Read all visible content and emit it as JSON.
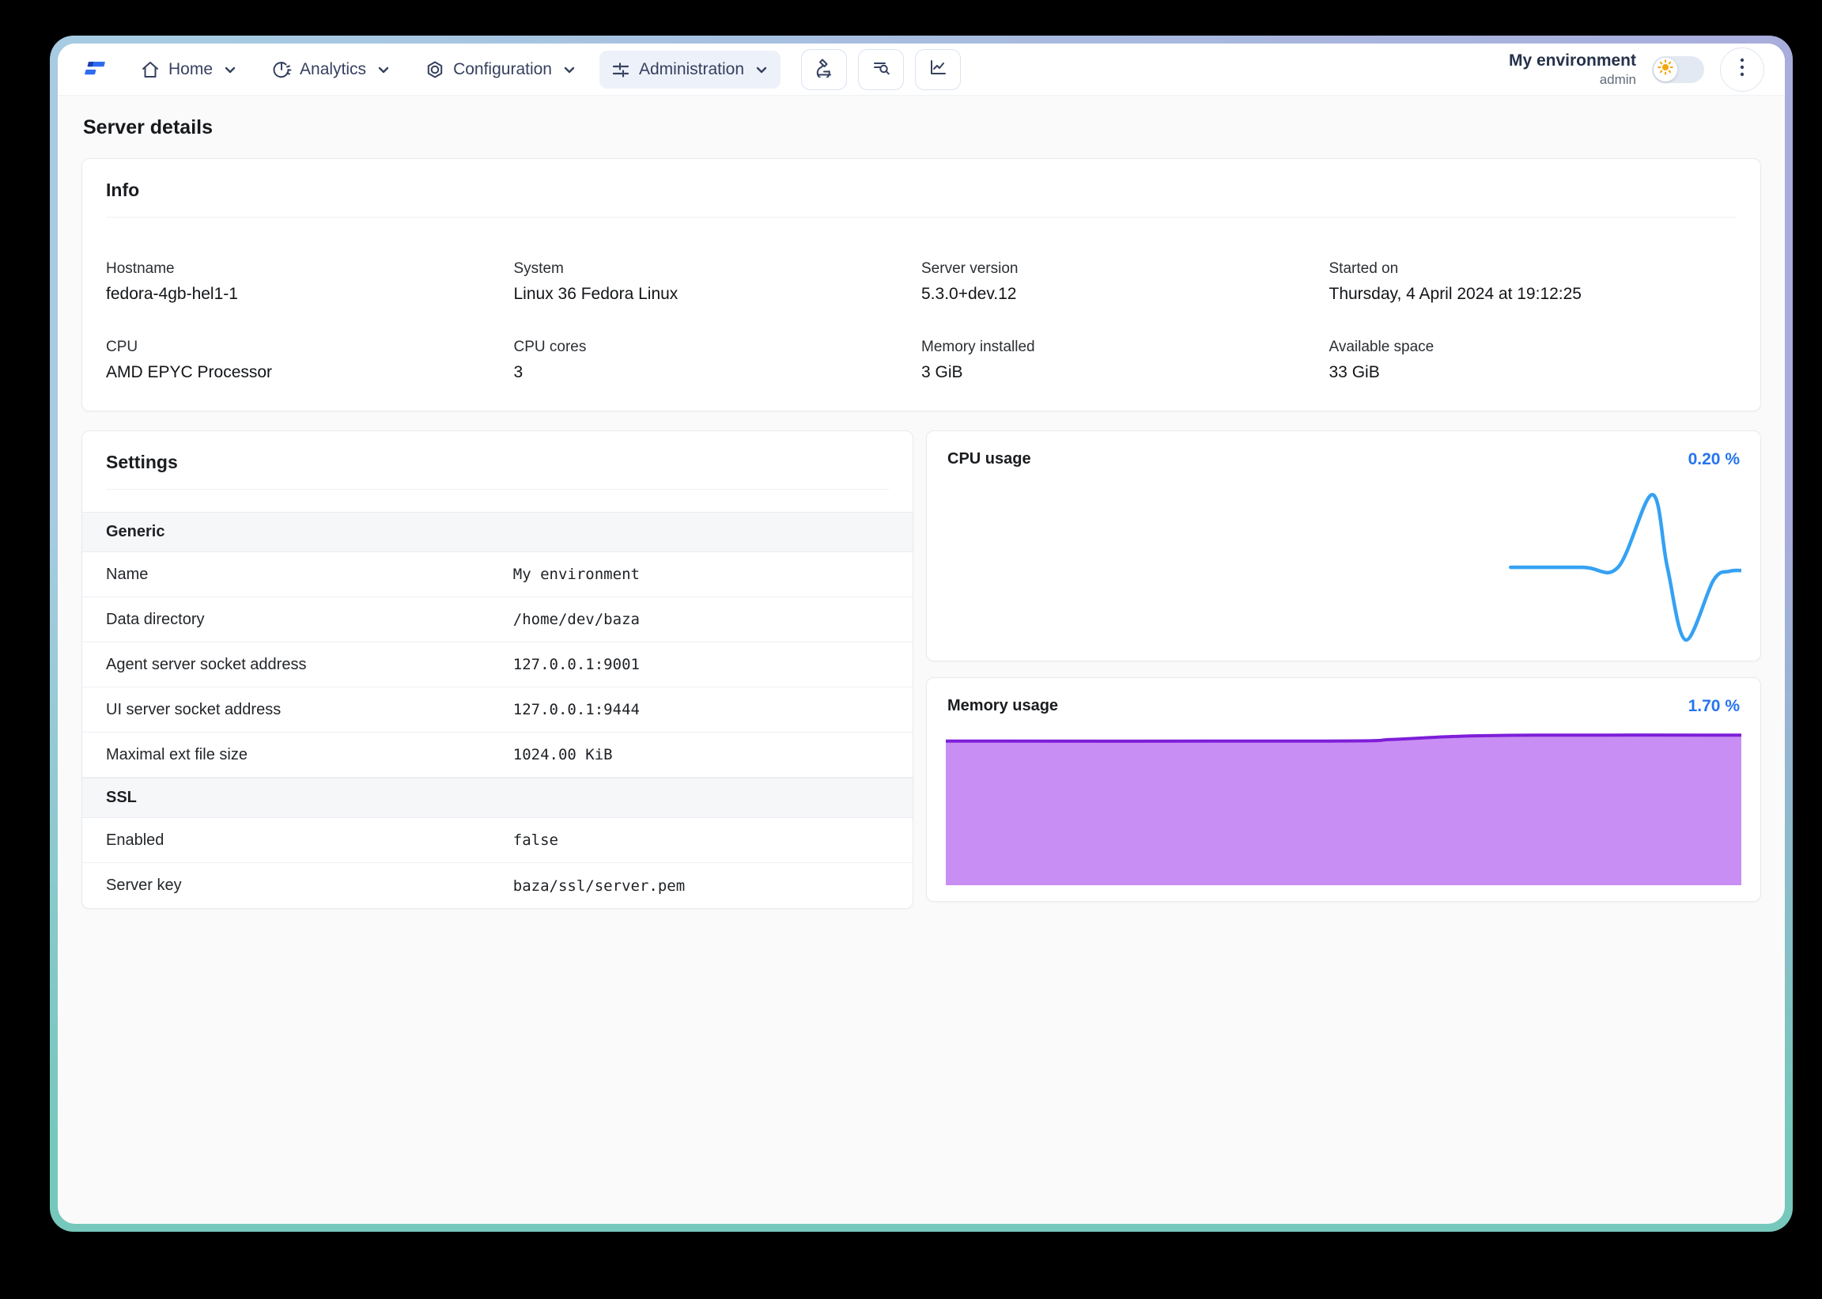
{
  "header": {
    "nav": [
      {
        "label": "Home",
        "icon": "home-icon"
      },
      {
        "label": "Analytics",
        "icon": "analytics-icon"
      },
      {
        "label": "Configuration",
        "icon": "configuration-icon"
      },
      {
        "label": "Administration",
        "icon": "sliders-icon",
        "active": true
      }
    ],
    "tool_buttons": [
      {
        "icon": "microscope-icon"
      },
      {
        "icon": "list-search-icon"
      },
      {
        "icon": "line-chart-icon"
      }
    ],
    "user": {
      "name": "My environment",
      "role": "admin"
    },
    "theme_toggle": {
      "icon": "sun-icon",
      "state": "light"
    }
  },
  "page": {
    "title": "Server details"
  },
  "info": {
    "title": "Info",
    "fields": [
      {
        "label": "Hostname",
        "value": "fedora-4gb-hel1-1"
      },
      {
        "label": "System",
        "value": "Linux 36 Fedora Linux"
      },
      {
        "label": "Server version",
        "value": "5.3.0+dev.12"
      },
      {
        "label": "Started on",
        "value": "Thursday, 4 April 2024 at 19:12:25"
      },
      {
        "label": "CPU",
        "value": "AMD EPYC Processor"
      },
      {
        "label": "CPU cores",
        "value": "3"
      },
      {
        "label": "Memory installed",
        "value": "3 GiB"
      },
      {
        "label": "Available space",
        "value": "33 GiB"
      }
    ]
  },
  "settings": {
    "title": "Settings",
    "sections": [
      {
        "name": "Generic",
        "rows": [
          {
            "label": "Name",
            "value": "My environment"
          },
          {
            "label": "Data directory",
            "value": "/home/dev/baza"
          },
          {
            "label": "Agent server socket address",
            "value": "127.0.0.1:9001"
          },
          {
            "label": "UI server socket address",
            "value": "127.0.0.1:9444"
          },
          {
            "label": "Maximal ext file size",
            "value": "1024.00 KiB"
          }
        ]
      },
      {
        "name": "SSL",
        "rows": [
          {
            "label": "Enabled",
            "value": "false"
          },
          {
            "label": "Server key",
            "value": "baza/ssl/server.pem"
          }
        ]
      }
    ]
  },
  "charts": {
    "cpu": {
      "title": "CPU usage",
      "value": "0.20 %",
      "line_color": "#35a1f3",
      "value_color": "#2574f0"
    },
    "memory": {
      "title": "Memory usage",
      "value": "1.70 %",
      "line_color": "#7d1ed8",
      "fill_color": "#c98ef3",
      "value_color": "#2574f0"
    }
  },
  "chart_data": [
    {
      "type": "line",
      "title": "CPU usage",
      "unit": "%",
      "current_value_pct": 0.2,
      "axes_hidden": true,
      "grid": false,
      "legend": false,
      "series": [
        {
          "name": "cpu_percent",
          "values": [
            0.2,
            0.2,
            0.2,
            0.2,
            0.2,
            0.45,
            0.02,
            0.15,
            0.2
          ]
        }
      ],
      "line_color": "#35a1f3",
      "norm_points": [
        [
          0.71,
          0.52
        ],
        [
          0.8,
          0.52
        ],
        [
          0.845,
          0.52
        ],
        [
          0.888,
          0.07
        ],
        [
          0.907,
          0.52
        ],
        [
          0.93,
          0.97
        ],
        [
          0.965,
          0.6
        ],
        [
          0.985,
          0.545
        ],
        [
          1,
          0.54
        ]
      ]
    },
    {
      "type": "area",
      "title": "Memory usage",
      "unit": "%",
      "current_value_pct": 1.7,
      "axes_hidden": true,
      "grid": false,
      "legend": false,
      "series": [
        {
          "name": "memory_percent",
          "values": [
            1.68,
            1.68,
            1.68,
            1.68,
            1.69,
            1.7,
            1.7,
            1.7
          ]
        }
      ],
      "line_color": "#7d1ed8",
      "fill_color": "#c98ef3",
      "norm_points": [
        [
          0,
          0.07
        ],
        [
          0.48,
          0.07
        ],
        [
          0.56,
          0.06
        ],
        [
          0.64,
          0.04
        ],
        [
          0.74,
          0.032
        ],
        [
          1,
          0.032
        ]
      ]
    }
  ],
  "colors": {
    "accent_blue": "#2574f0",
    "cpu_line": "#35a1f3",
    "memory_fill": "#c98ef3",
    "memory_line": "#7d1ed8",
    "nav_text": "#36415f",
    "frame_top": "#a6cbe2",
    "frame_right": "#a9abdc",
    "frame_bottom": "#76c8bc"
  }
}
